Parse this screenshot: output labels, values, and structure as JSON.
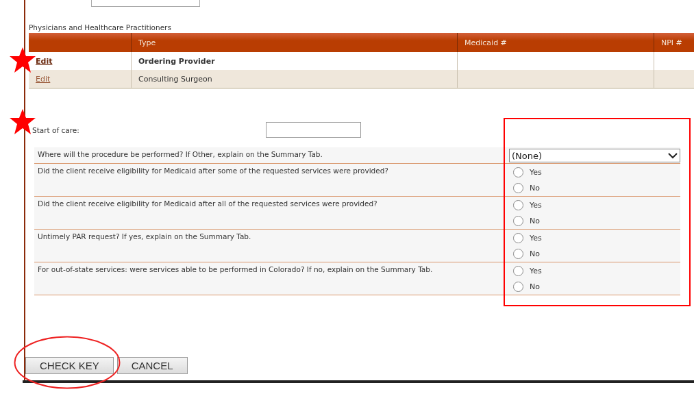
{
  "section_title": "Physicians and Healthcare Practitioners",
  "table": {
    "columns": [
      "Type",
      "Medicaid #",
      "NPI #"
    ],
    "rows": [
      {
        "link": "Edit",
        "type": "Ordering Provider",
        "emphasized": true
      },
      {
        "link": "Edit",
        "type": "Consulting Surgeon",
        "emphasized": false
      }
    ]
  },
  "start_of_care": {
    "label": "Start of care:"
  },
  "questions": [
    {
      "kind": "select",
      "text": "Where will the procedure be performed? If Other, explain on the Summary Tab.",
      "value": "(None)"
    },
    {
      "kind": "radio",
      "text": "Did the client receive eligibility for Medicaid after some of the requested services were provided?",
      "options": [
        {
          "label": "Yes",
          "selected": false
        },
        {
          "label": "No",
          "selected": false
        }
      ]
    },
    {
      "kind": "radio",
      "text": "Did the client receive eligibility for Medicaid after all of the requested services were provided?",
      "options": [
        {
          "label": "Yes",
          "selected": false
        },
        {
          "label": "No",
          "selected": false
        }
      ]
    },
    {
      "kind": "radio",
      "text": "Untimely PAR request? If yes, explain on the Summary Tab.",
      "options": [
        {
          "label": "Yes",
          "selected": false
        },
        {
          "label": "No",
          "selected": false
        }
      ]
    },
    {
      "kind": "radio",
      "text": "For out-of-state services: were services able to be performed in Colorado? If no, explain on the Summary Tab.",
      "options": [
        {
          "label": "Yes",
          "selected": false
        },
        {
          "label": "No",
          "selected": false
        }
      ]
    }
  ],
  "buttons": [
    "CHECK KEY",
    "CANCEL"
  ],
  "annotations": [
    {
      "kind": "star"
    },
    {
      "kind": "star"
    },
    {
      "kind": "frame"
    },
    {
      "kind": "ellipse"
    }
  ]
}
